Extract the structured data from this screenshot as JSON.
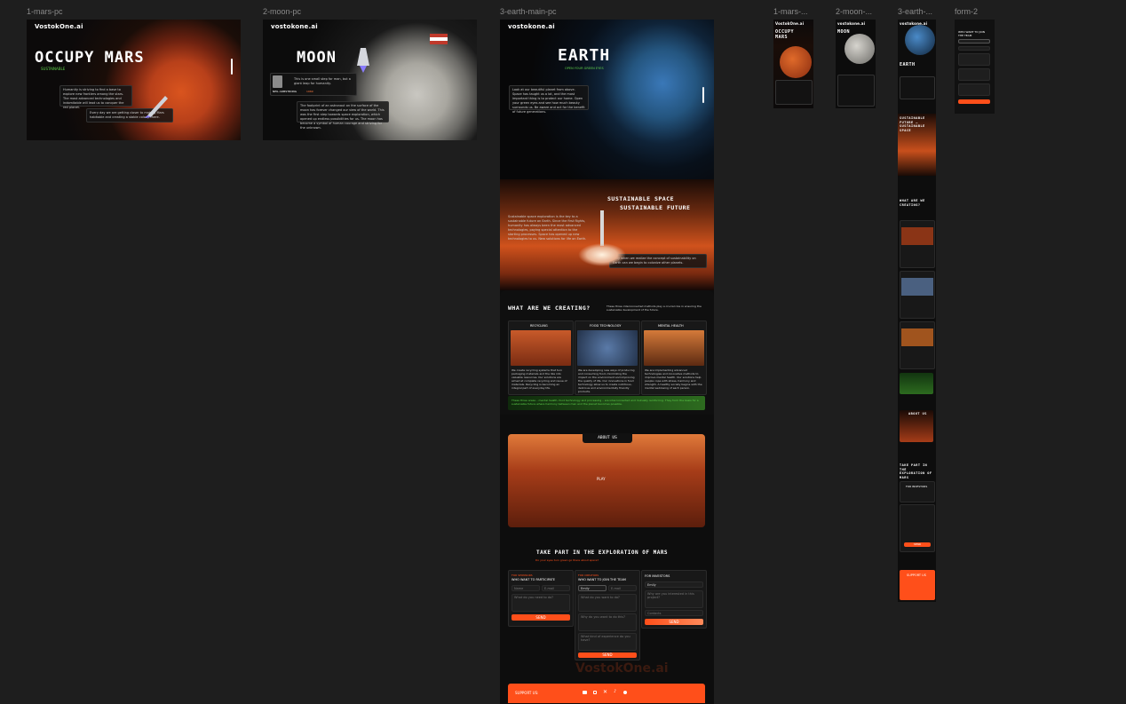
{
  "frames": {
    "mars_pc": "1-mars-pc",
    "moon_pc": "2-moon-pc",
    "earth_pc": "3-earth-main-pc",
    "mars_m": "1-mars-...",
    "moon_m": "2-moon-...",
    "earth_m": "3-earth-...",
    "form": "form-2"
  },
  "logo": "VostokOne.ai",
  "logo_lower": "vostokone.ai",
  "mars": {
    "title": "OCCUPY MARS",
    "subtitle": "SUSTAINABLE",
    "p1": "Humanity is striving to find a base to explore new frontiers among the stars. The most advanced technologies and indomitable will lead us to conquer the red planet.",
    "p2": "Every day we are getting closer to making Mars habitable and creating a stable colony there."
  },
  "moon": {
    "title": "MOON",
    "quote": "This is one small step for man, but a giant leap for humanity.",
    "author": "NEIL ARMSTRONG",
    "year": "1969",
    "p": "The footprint of an astronaut on the surface of the moon has forever changed our view of the world. This was the first step towards space exploration, which opened up endless possibilities for us. The moon has become a symbol of human courage and striving for the unknown."
  },
  "earth": {
    "title": "EARTH",
    "subtitle": "OPEN YOUR GREEN EYES",
    "p": "Look at our beautiful planet from above. Space has taught us a lot, and the most important thing is to protect our home. Open your green eyes and see how much beauty surrounds us. Be aware and act for the benefit of future generations.",
    "sust_title_1": "SUSTAINABLE SPACE",
    "sust_title_2": "SUSTAINABLE FUTURE",
    "sust_p1": "Sustainable space exploration is the key to a sustainable future on Earth. Since the first flights, humanity has always been the most advanced technologies, paying special attention to the starting processes. Space has opened up new technologies to us. New solutions for life on Earth.",
    "sust_p2": "Only when we realize the concept of sustainability on Earth can we begin to colonize other planets.",
    "creating_title": "WHAT ARE WE CREATING?",
    "creating_sub": "These three interconnected methods play a crucial role in ensuring the sustainable development of the future.",
    "cards": [
      {
        "label": "RECYCLING",
        "text": "We create recycling systems that turn packaging materials and the like into valuable resources. Our solutions are aimed at complete recycling and reuse of materials. Recycling is becoming an integral part of everyday life."
      },
      {
        "label": "FOOD TECHNOLOGY",
        "text": "We are developing new ways of producing and consuming food, minimizing the impact on the environment and improving the quality of life. Our innovations in food technology allow us to create nutritious, delicious and environmentally friendly products."
      },
      {
        "label": "MENTAL HEALTH",
        "text": "We are implementing advanced technologies and innovative methods to improve mental health. Our solutions help people cope with stress, harmony and strength. A healthy society begins with the mental well-being of each person."
      }
    ],
    "banner": "These three areas – mental health, food technology and processing – are interconnected and mutually reinforcing. They form the basis for a sustainable future where harmony between man and the planet becomes possible.",
    "about": "ABOUT US",
    "play": "PLAY",
    "take_part": "TAKE PART IN THE EXPLORATION OF MARS",
    "take_part_sub": "Do your eyes turn green go there about space?",
    "form1_label": "FOR SPONSORS",
    "form1_title": "WHO WANT TO PARTICIPATE",
    "form2_label": "FOR CREATORS",
    "form2_title": "WHO WANT TO JOIN THE TEAM",
    "form3_title": "FOR INVESTORS",
    "name": "Name",
    "email": "E-mail",
    "q1": "What do you need to do?",
    "q2": "What do you want to do?",
    "q3": "Why do you want to do this?",
    "q4": "What kind of experience do you have?",
    "q5": "Why are you interested in this project?",
    "q6": "Contacts",
    "name_val": "Emily",
    "send": "SEND",
    "footer_logo": "VostokOne.ai",
    "support": "SUPPORT US:"
  },
  "mobile": {
    "mars_title": "OCCUPY MARS",
    "moon_title": "MOON",
    "earth_title": "EARTH",
    "sust": "SUSTAINABLE FUTURE — SUSTAINABLE SPACE",
    "creating": "WHAT ARE WE CREATING?",
    "about": "ABOUT US",
    "take_part": "TAKE PART IN THE EXPLORATION OF MARS",
    "investors": "FOR INVESTORS",
    "support": "SUPPORT US",
    "form_title": "WHO WANT TO JOIN THE TEAM"
  },
  "colors": {
    "accent": "#ff4f1a",
    "green": "#5fd14c",
    "canvas": "#1e1e1e"
  }
}
